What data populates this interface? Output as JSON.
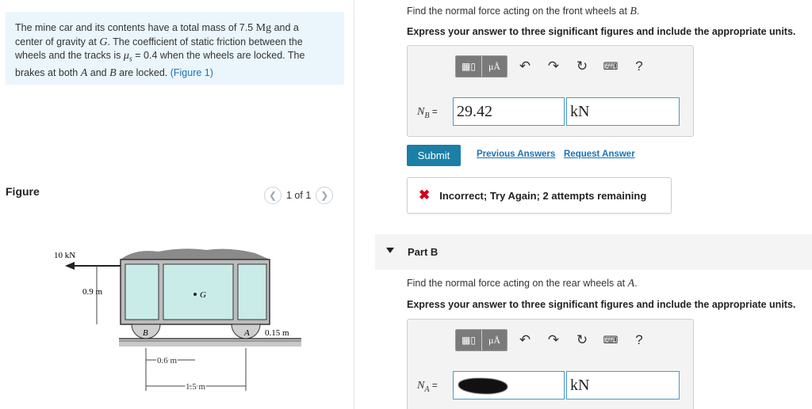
{
  "problem": {
    "line1_pre": "The mine car and its contents have a total mass of 7.5 ",
    "line1_unit": "Mg",
    "line1_post": " and a",
    "line2_pre": "center of gravity at ",
    "line2_var": "G",
    "line2_post": ". The coefficient of static friction between the",
    "line3_pre": "wheels and the tracks is ",
    "line3_var": "μ",
    "line3_sub": "s",
    "line3_post": " = 0.4 when the wheels are locked. The",
    "line4_pre": "brakes at both ",
    "line4_var_a": "A",
    "line4_mid": " and ",
    "line4_var_b": "B",
    "line4_post": " are locked. ",
    "figure_link": "(Figure 1)"
  },
  "figure": {
    "label": "Figure",
    "pager": "1 of 1",
    "prev_icon": "chevron-left-icon",
    "next_icon": "chevron-right-icon",
    "force_label": "10 kN",
    "height_label": "0.9 m",
    "cg_label": "G",
    "wheel_b": "B",
    "wheel_a": "A",
    "small_dim": "0.15 m",
    "dim_06": "0.6 m",
    "dim_15": "1.5 m"
  },
  "partA": {
    "question_pre": "Find the normal force acting on the front wheels at ",
    "question_var": "B",
    "question_post": ".",
    "instruction": "Express your answer to three significant figures and include the appropriate units.",
    "label_sym": "N",
    "label_sub": "B",
    "label_eq": " =",
    "value": "29.42",
    "unit": "kN",
    "submit": "Submit",
    "prev_answers": "Previous Answers",
    "request_answer": "Request Answer",
    "feedback": "Incorrect; Try Again; 2 attempts remaining"
  },
  "partB": {
    "title": "Part B",
    "question_pre": "Find the normal force acting on the rear wheels at ",
    "question_var": "A",
    "question_post": ".",
    "instruction": "Express your answer to three significant figures and include the appropriate units.",
    "label_sym": "N",
    "label_sub": "A",
    "label_eq": " =",
    "unit": "kN"
  },
  "toolbar": {
    "templates_icon": "templates-icon",
    "units_label": "μÅ",
    "undo_icon": "undo-icon",
    "redo_icon": "redo-icon",
    "reset_icon": "reset-icon",
    "keyboard_icon": "keyboard-icon",
    "help_label": "?"
  },
  "colors": {
    "accent": "#1b7fa6",
    "link": "#1a73b8",
    "error": "#d0021b",
    "problem_bg": "#eaf6fb"
  }
}
